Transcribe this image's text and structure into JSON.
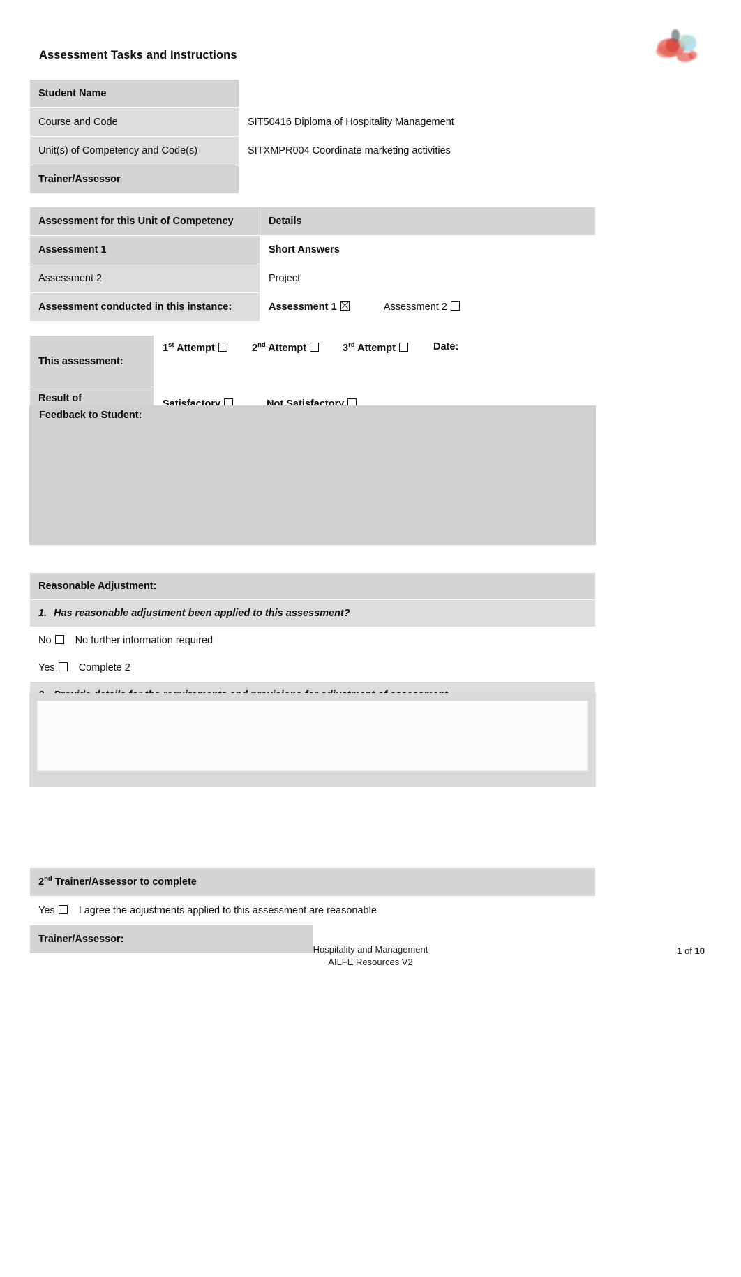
{
  "header": {
    "title": "Assessment Tasks and Instructions",
    "logo_icon": "institute-logo"
  },
  "student_details": {
    "rows": [
      {
        "label": "Student Name",
        "value": "",
        "bold": true
      },
      {
        "label": "Course and Code",
        "value": "SIT50416 Diploma of Hospitality Management",
        "bold": false
      },
      {
        "label": "Unit(s) of Competency and Code(s)",
        "value": "SITXMPR004 Coordinate marketing activities",
        "bold": false
      },
      {
        "label": "Trainer/Assessor",
        "value": "",
        "bold": true
      }
    ]
  },
  "assessment_table": {
    "header_left": "Assessment for this Unit of Competency",
    "header_right": "Details",
    "rows": [
      {
        "label": "Assessment 1",
        "detail": "Short Answers"
      },
      {
        "label": "Assessment 2",
        "detail": "Project"
      }
    ],
    "conducted_label": "Assessment conducted in this instance:",
    "conducted_options": [
      {
        "label": "Assessment 1",
        "checked": true
      },
      {
        "label": "Assessment 2",
        "checked": false
      }
    ]
  },
  "attempt_table": {
    "this_assessment_label": "This assessment:",
    "attempts": [
      {
        "ordinal": "1",
        "suffix": "st",
        "label": "Attempt",
        "checked": false
      },
      {
        "ordinal": "2",
        "suffix": "nd",
        "label": "Attempt",
        "checked": false
      },
      {
        "ordinal": "3",
        "suffix": "rd",
        "label": "Attempt",
        "checked": false
      }
    ],
    "date_label": "Date:",
    "date_value": "",
    "result_label": "Result of Assessment:",
    "result_options": [
      {
        "label": "Satisfactory",
        "checked": false
      },
      {
        "label": "Not Satisfactory",
        "checked": false
      }
    ],
    "feedback_label": "Feedback to Student:",
    "feedback_value": ""
  },
  "reasonable_adjustment": {
    "title": "Reasonable Adjustment:",
    "q1_number": "1.",
    "q1_text": "Has reasonable adjustment been applied to this assessment?",
    "no_label": "No",
    "no_text": "No further information required",
    "no_checked": false,
    "yes_label": "Yes",
    "yes_text": "Complete 2",
    "yes_checked": false,
    "q2_number": "2.",
    "q2_text": "Provide details for the requirements and provisions for adjustment of assessment.",
    "q2_value": ""
  },
  "second_assessor": {
    "title_ordinal": "2",
    "title_suffix": "nd",
    "title_rest": " Trainer/Assessor to complete",
    "agree_label": "Yes",
    "agree_text": "I agree the adjustments applied to this assessment are reasonable",
    "agree_checked": false,
    "trainer_label": "Trainer/Assessor:",
    "trainer_value": ""
  },
  "footer": {
    "line1": "Hospitality and Management",
    "line2": "AILFE Resources V2",
    "page_current": "1",
    "page_of": " of ",
    "page_total": "10"
  },
  "colors": {
    "shade_dark": "#d4d4d4",
    "shade_light": "#f4f4f4",
    "text": "#0d0d0d"
  }
}
